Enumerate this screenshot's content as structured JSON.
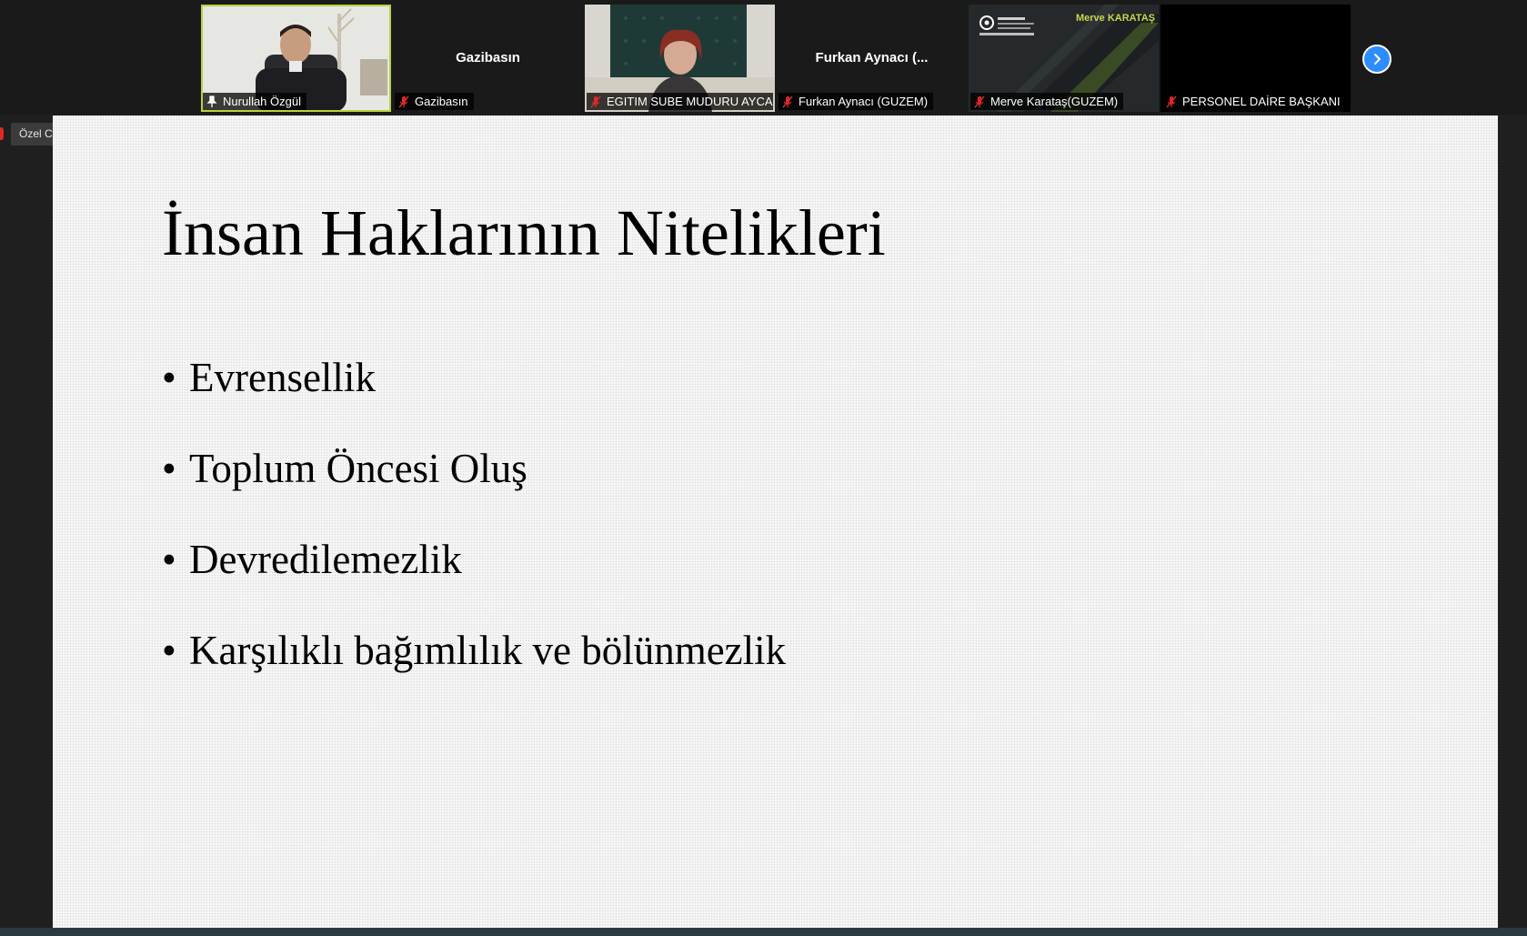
{
  "gallery": {
    "participants": [
      {
        "display_name": "",
        "label": "Nurullah Özgül",
        "video": "man",
        "active": true,
        "mic_icon": "pin-icon"
      },
      {
        "display_name": "Gazibasın",
        "label": "Gazibasın",
        "video": "none",
        "active": false,
        "mic_icon": "mic-muted-icon"
      },
      {
        "display_name": "",
        "label": "EGITIM SUBE MUDURU AYCA ...",
        "video": "woman",
        "active": false,
        "mic_icon": "mic-muted-icon"
      },
      {
        "display_name": "Furkan Aynacı (...",
        "label": "Furkan Aynacı (GUZEM)",
        "video": "none",
        "active": false,
        "mic_icon": "mic-muted-icon"
      },
      {
        "display_name": "",
        "label": "Merve Karataş(GUZEM)",
        "video": "logo",
        "logo_text": "Merve KARATAŞ",
        "active": false,
        "mic_icon": "mic-muted-icon"
      },
      {
        "display_name": "",
        "label": "PERSONEL DAİRE BAŞKANI",
        "video": "black",
        "active": false,
        "mic_icon": "mic-muted-icon"
      }
    ],
    "next_icon": "chevron-right-icon"
  },
  "live_stream": {
    "label": "Özel Canlı Yayın Hizmeti"
  },
  "slide": {
    "title": "İnsan Haklarının Nitelikleri",
    "bullets": [
      "Evrensellik",
      "Toplum Öncesi Oluş",
      "Devredilemezlik",
      "Karşılıklı bağımlılık ve bölünmezlik"
    ]
  },
  "colors": {
    "active_border": "#b5d43a",
    "accent_blue": "#2d8cff",
    "muted_red": "#e02828"
  }
}
